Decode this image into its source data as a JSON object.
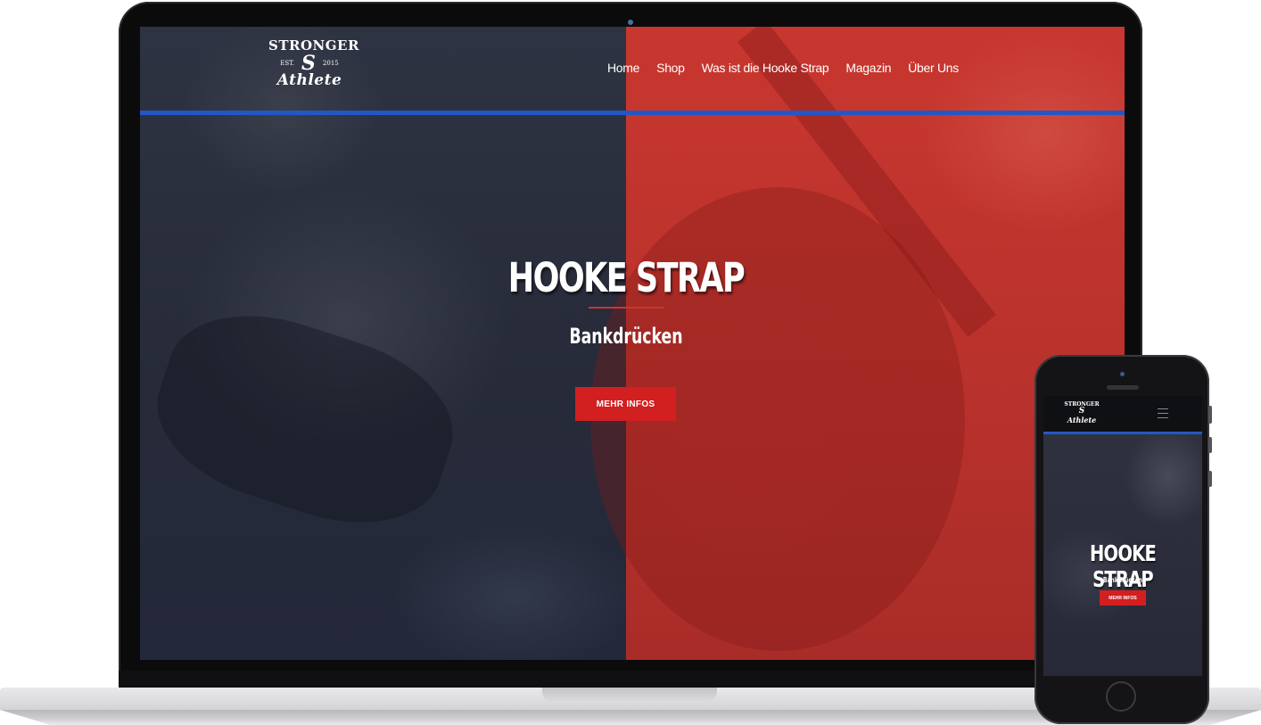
{
  "laptop": {
    "logo": {
      "top": "STRONGER",
      "est": "EST.",
      "letter": "S",
      "year": "2015",
      "bottom": "Athlete"
    },
    "nav": {
      "items": [
        "Home",
        "Shop",
        "Was ist die Hooke Strap",
        "Magazin",
        "Über Uns"
      ]
    },
    "hero": {
      "title": "HOOKE STRAP",
      "subtitle": "Bankdrücken",
      "button": "MEHR INFOS"
    }
  },
  "phone": {
    "logo": {
      "top": "STRONGER",
      "letter": "S",
      "bottom": "Athlete"
    },
    "menu_icon": "hamburger-icon",
    "hero": {
      "title": "HOOKE STRAP",
      "subtitle": "Bankdrücken",
      "button": "MEHR INFOS"
    }
  },
  "colors": {
    "accent_red": "#d21f20",
    "nav_blue": "#2457c5",
    "panel_red": "#c8372f",
    "panel_dark": "#2b2f3d"
  }
}
